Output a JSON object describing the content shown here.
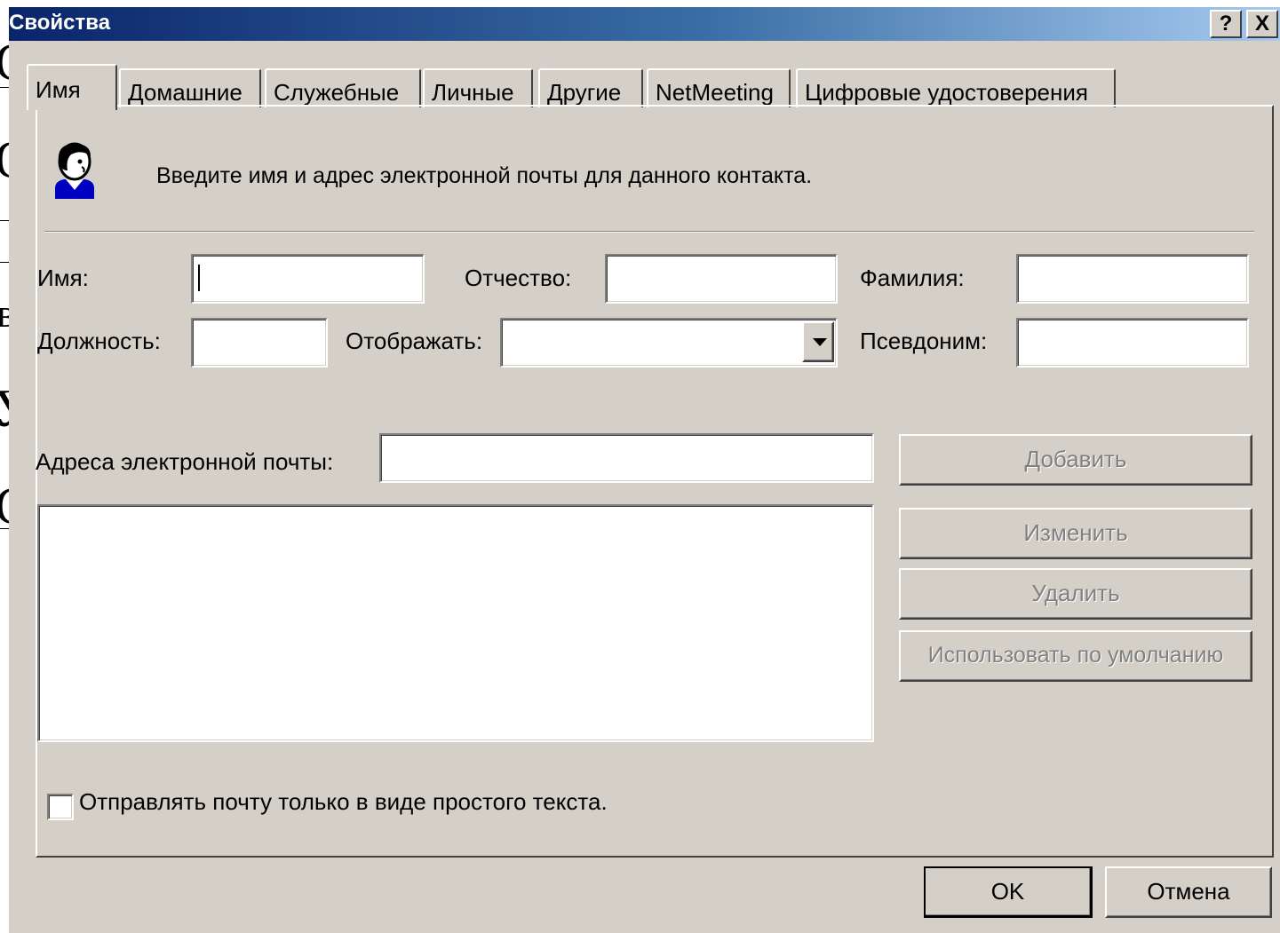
{
  "window": {
    "title": "Свойства",
    "help_label": "?",
    "close_label": "X"
  },
  "tabs": [
    {
      "label": "Имя"
    },
    {
      "label": "Домашние"
    },
    {
      "label": "Служебные"
    },
    {
      "label": "Личные"
    },
    {
      "label": "Другие"
    },
    {
      "label": "NetMeeting"
    },
    {
      "label": "Цифровые удостоверения"
    }
  ],
  "header": {
    "instruction": "Введите имя и адрес электронной почты для данного контакта."
  },
  "fields": {
    "first_name": {
      "label": "Имя:",
      "value": ""
    },
    "middle_name": {
      "label": "Отчество:",
      "value": ""
    },
    "last_name": {
      "label": "Фамилия:",
      "value": ""
    },
    "title": {
      "label": "Должность:",
      "value": ""
    },
    "display": {
      "label": "Отображать:",
      "value": ""
    },
    "nickname": {
      "label": "Псевдоним:",
      "value": ""
    },
    "email": {
      "label": "Адреса электронной почты:",
      "value": ""
    }
  },
  "email_buttons": {
    "add": "Добавить",
    "edit": "Изменить",
    "remove": "Удалить",
    "set_default": "Использовать по умолчанию"
  },
  "plain_text": {
    "label": "Отправлять почту только в виде простого текста.",
    "checked": false
  },
  "footer": {
    "ok": "OK",
    "cancel": "Отмена"
  },
  "colors": {
    "dialog_bg": "#d4d0c8",
    "title_start": "#0a246a",
    "title_end": "#a6caf0",
    "disabled_text": "#808080"
  }
}
